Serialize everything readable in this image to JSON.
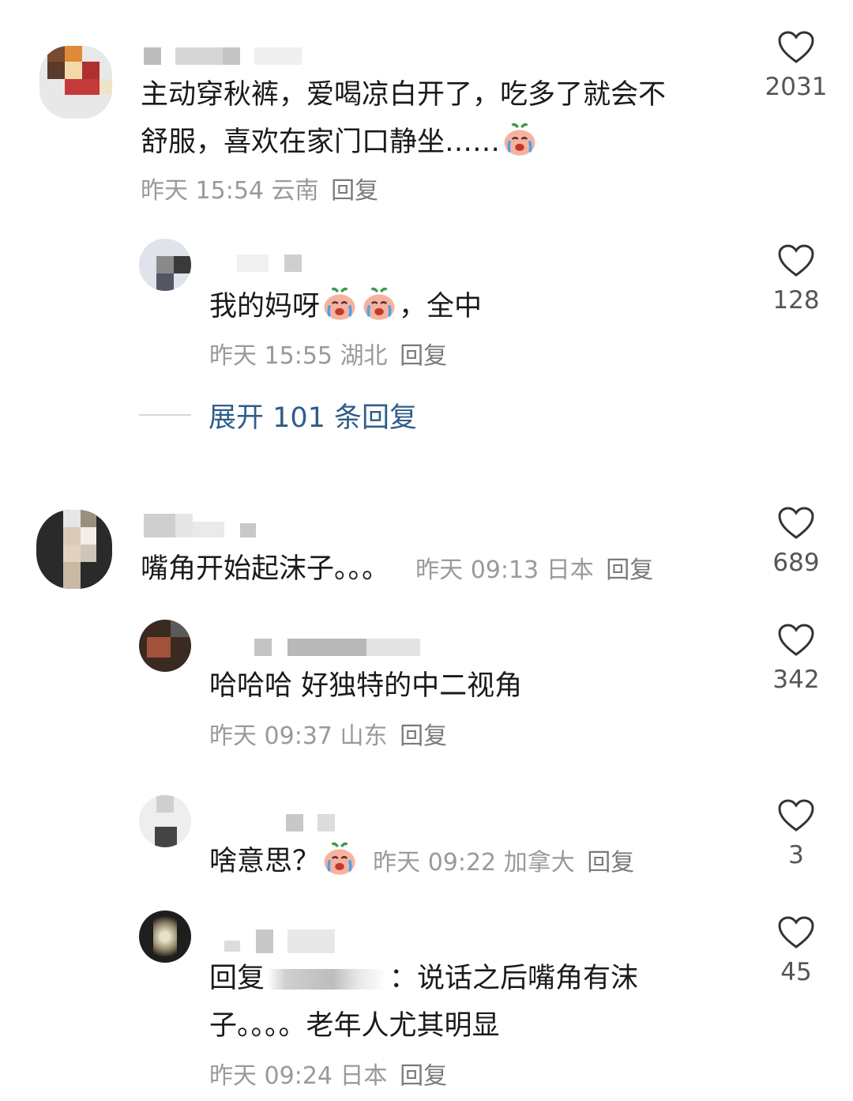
{
  "comments": [
    {
      "text_lines": [
        "主动穿秋裤，爱喝凉白开了，吃多了就会不",
        "舒服，喜欢在家门口静坐……"
      ],
      "emoji": "crying-emoji",
      "time": "昨天 15:54",
      "location": "云南",
      "reply_label": "回复",
      "likes": "2031"
    },
    {
      "text_prefix": "我的妈呀",
      "text_suffix": "，全中",
      "emoji": "crying-emoji",
      "time": "昨天 15:55",
      "location": "湖北",
      "reply_label": "回复",
      "likes": "128"
    },
    {
      "text": "嘴角开始起沫子。。。",
      "time": "昨天 09:13",
      "location": "日本",
      "reply_label": "回复",
      "likes": "689"
    },
    {
      "text": "哈哈哈 好独特的中二视角",
      "time": "昨天 09:37",
      "location": "山东",
      "reply_label": "回复",
      "likes": "342"
    },
    {
      "text": "啥意思？",
      "emoji": "crying-emoji",
      "time": "昨天 09:22",
      "location": "加拿大",
      "reply_label": "回复",
      "likes": "3"
    },
    {
      "reply_prefix": "回复",
      "text_line1_suffix": "：说话之后嘴角有沫",
      "text_line2": "子。。。。老年人尤其明显",
      "time": "昨天 09:24",
      "location": "日本",
      "reply_label": "回复",
      "likes": "45"
    }
  ],
  "expand_replies": {
    "label": "展开 101 条回复"
  },
  "colors": {
    "link": "#2f5d8a",
    "meta": "#9a9a9a",
    "heart": "#333333"
  }
}
